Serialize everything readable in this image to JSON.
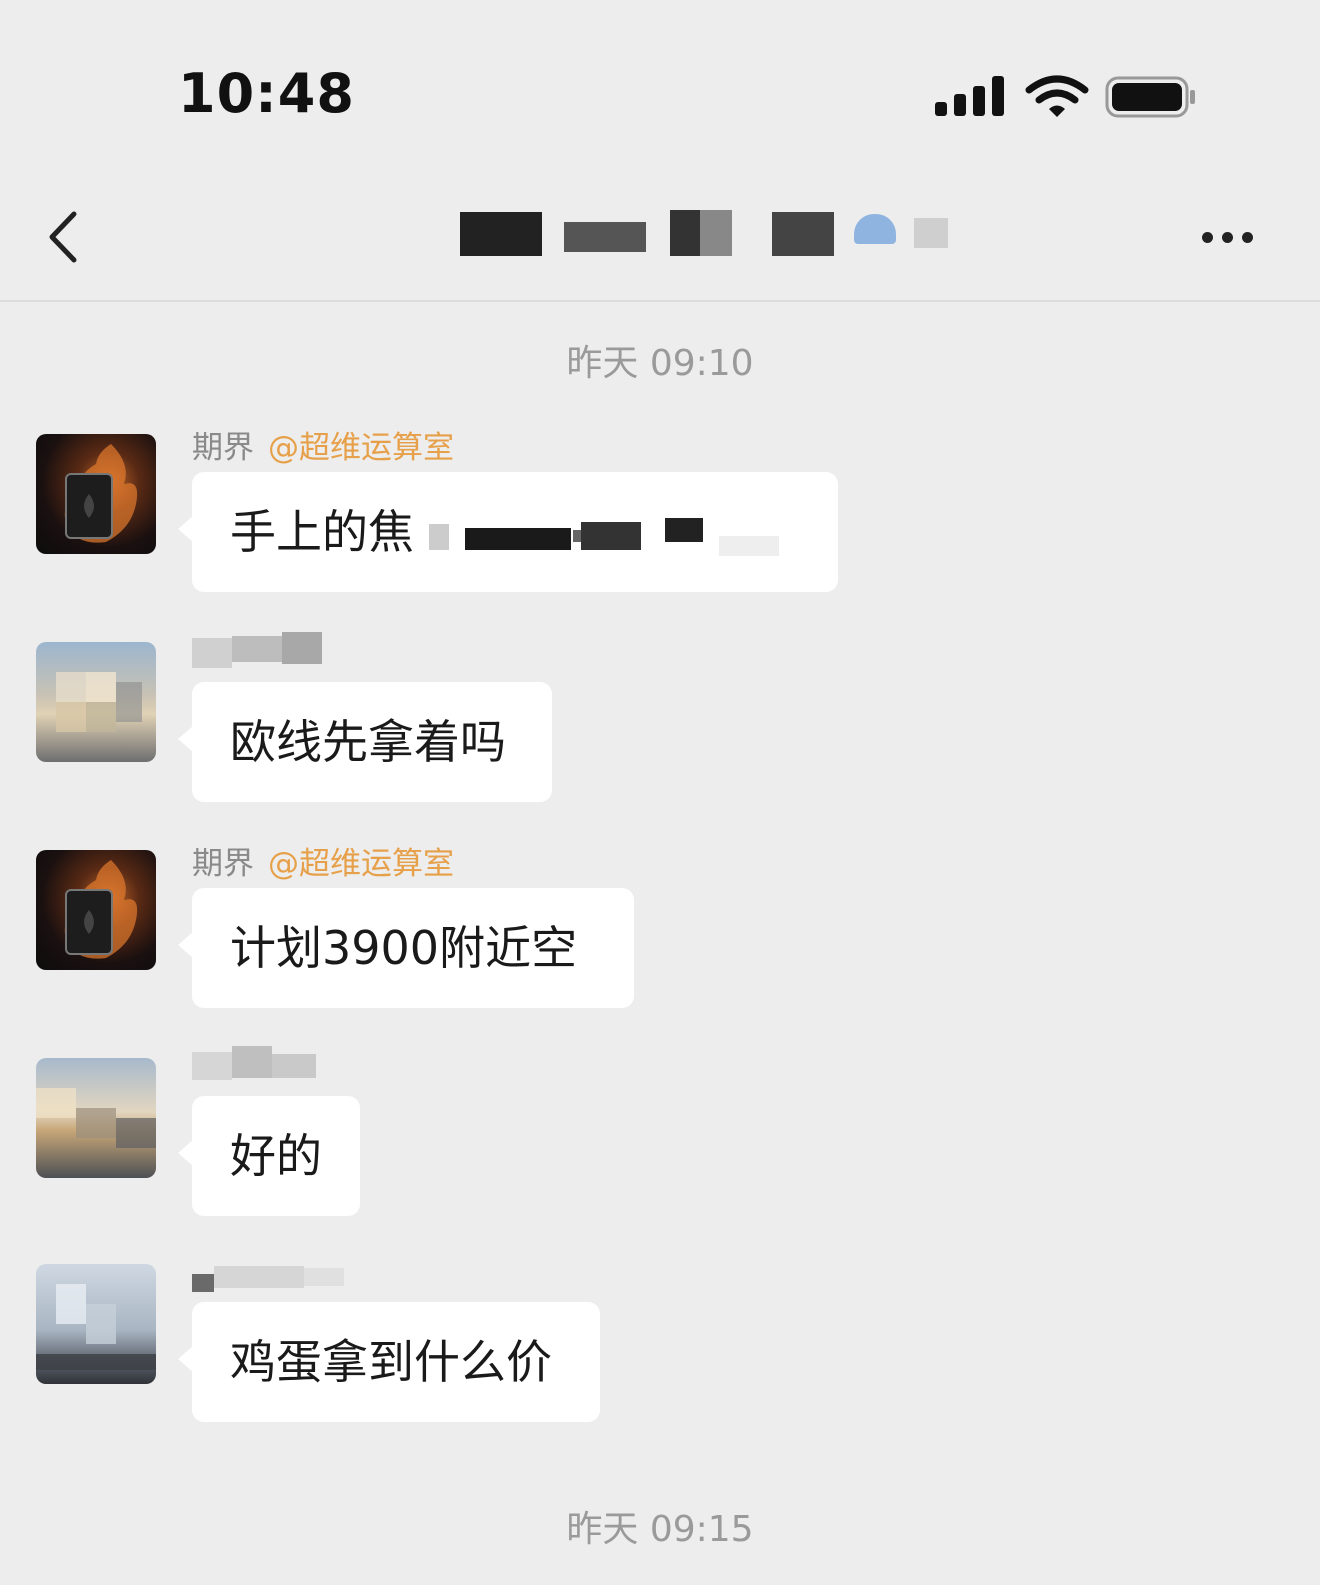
{
  "status_bar": {
    "time": "10:48",
    "icons": [
      "signal-icon",
      "wifi-icon",
      "battery-icon"
    ]
  },
  "nav_bar": {
    "back_icon": "chevron-left-icon",
    "more_icon": "more-dots-icon"
  },
  "timestamps": [
    "昨天 09:10",
    "昨天 09:15"
  ],
  "messages": [
    {
      "sender": "期界",
      "mention": "@超维运算室",
      "text": "手上的焦"
    },
    {
      "sender": "",
      "mention": "",
      "text": "欧线先拿着吗"
    },
    {
      "sender": "期界",
      "mention": "@超维运算室",
      "text": "计划3900附近空"
    },
    {
      "sender": "",
      "mention": "",
      "text": "好的"
    },
    {
      "sender": "",
      "mention": "",
      "text": "鸡蛋拿到什么价"
    }
  ],
  "colors": {
    "background": "#ededed",
    "bubble": "#ffffff",
    "mention": "#e7a04a",
    "timestamp": "#9a9a9a"
  }
}
